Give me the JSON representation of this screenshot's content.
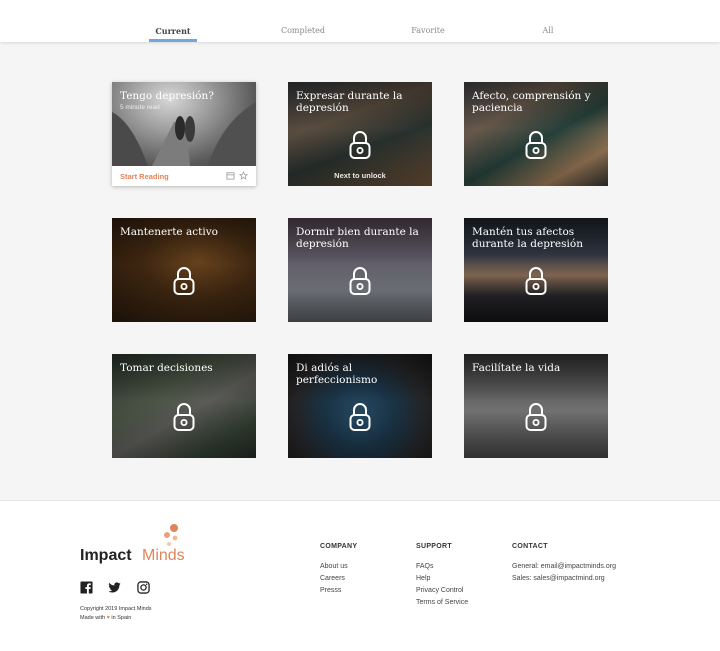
{
  "tabs": [
    {
      "label": "Current",
      "active": true
    },
    {
      "label": "Completed",
      "active": false
    },
    {
      "label": "Favorite",
      "active": false
    },
    {
      "label": "All",
      "active": false
    }
  ],
  "current_card": {
    "title": "Tengo depresión?",
    "read_time": "5 minute read",
    "action": "Start Reading",
    "icons": [
      "calendar-icon",
      "star-icon"
    ]
  },
  "locked_cards": [
    {
      "title": "Expresar durante la depresión",
      "note": "Next to unlock"
    },
    {
      "title": "Afecto, comprensión y paciencia"
    },
    {
      "title": "Mantenerte activo"
    },
    {
      "title": "Dormir bien durante la depresión"
    },
    {
      "title": "Mantén tus afectos durante la depresión"
    },
    {
      "title": "Tomar decisiones"
    },
    {
      "title": "Di adiós al perfeccionismo"
    },
    {
      "title": "Facilítate la vida"
    }
  ],
  "footer": {
    "logo": {
      "word1": "Impact",
      "word2": "Minds"
    },
    "social_icons": [
      "facebook-icon",
      "twitter-icon",
      "instagram-icon"
    ],
    "copyright": "Copyright 2019 Impact Minds",
    "made_with_prefix": "Made with",
    "made_with_suffix": "in Spain",
    "company": {
      "heading": "COMPANY",
      "links": [
        "About us",
        "Careers",
        "Presss"
      ]
    },
    "support": {
      "heading": "SUPPORT",
      "links": [
        "FAQs",
        "Help",
        "Privacy Control",
        "Terms of Service"
      ]
    },
    "contact": {
      "heading": "CONTACT",
      "links": [
        "General: email@impactminds.org",
        "Sales: sales@impactmind.org"
      ]
    }
  },
  "colors": {
    "accent": "#e0855a",
    "tab_underline": "#6fa8dc",
    "heart": "#e0855a"
  }
}
